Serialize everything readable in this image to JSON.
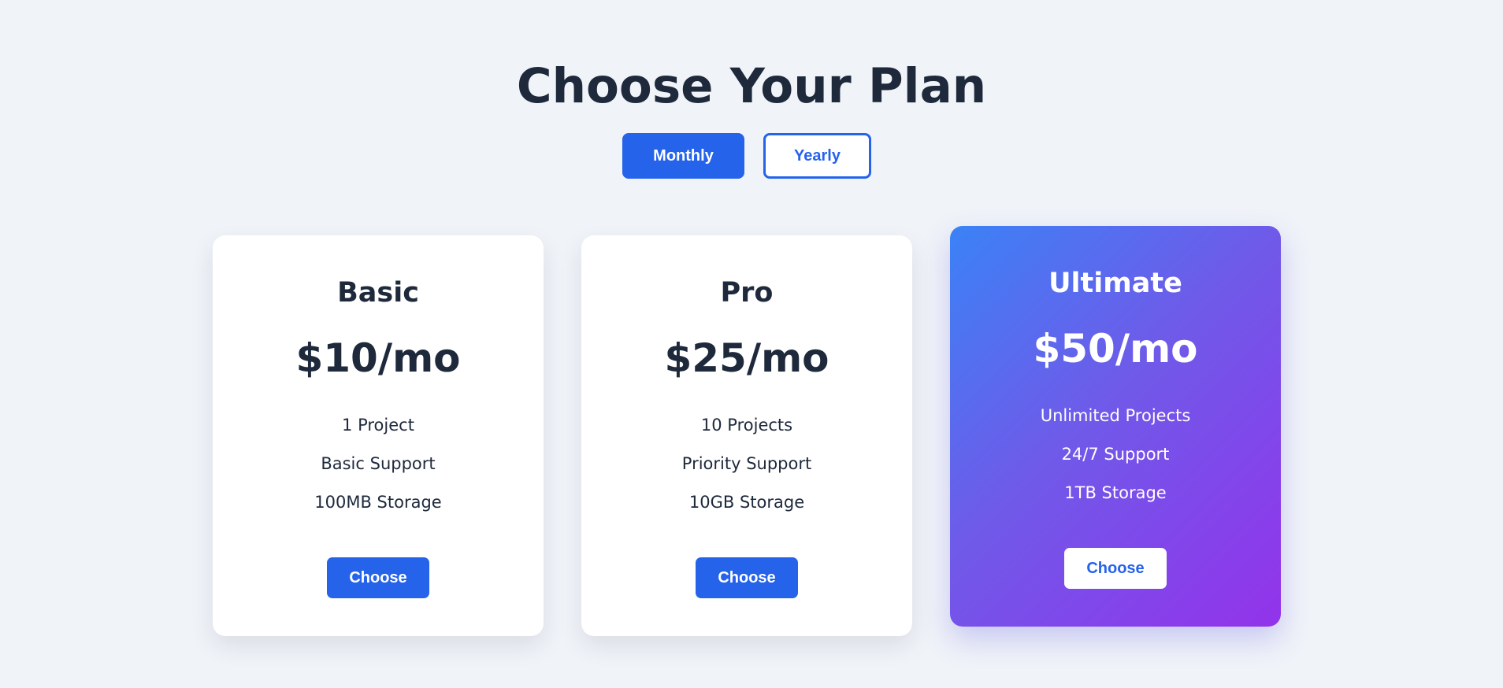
{
  "header": {
    "title": "Choose Your Plan"
  },
  "billing_toggle": {
    "monthly_label": "Monthly",
    "yearly_label": "Yearly",
    "selected": "Monthly"
  },
  "plans": [
    {
      "name": "Basic",
      "price": "$10/mo",
      "features": [
        "1 Project",
        "Basic Support",
        "100MB Storage"
      ],
      "button_label": "Choose"
    },
    {
      "name": "Pro",
      "price": "$25/mo",
      "features": [
        "10 Projects",
        "Priority Support",
        "10GB Storage"
      ],
      "button_label": "Choose"
    },
    {
      "name": "Ultimate",
      "price": "$50/mo",
      "features": [
        "Unlimited Projects",
        "24/7 Support",
        "1TB Storage"
      ],
      "button_label": "Choose",
      "highlighted": true
    }
  ],
  "colors": {
    "background": "#f0f3f8",
    "accent": "#2563eb",
    "text": "#1e293b",
    "highlight_gradient_start": "#3b82f6",
    "highlight_gradient_end": "#9333ea"
  }
}
